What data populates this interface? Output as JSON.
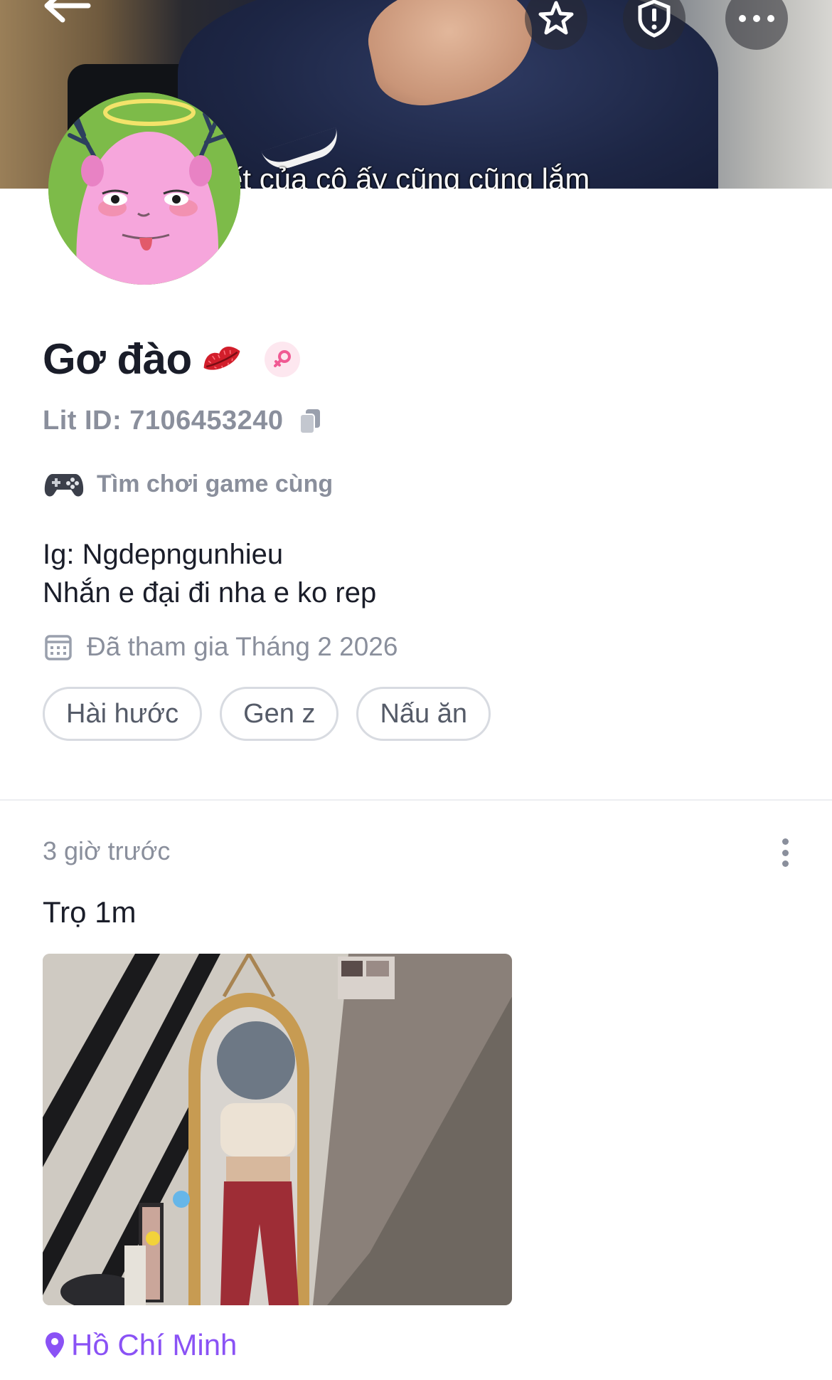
{
  "cover": {
    "subtitle": "ết của cô ấy cũng cũng lắm",
    "icons": [
      "back-arrow-icon",
      "star-icon",
      "report-icon",
      "more-icon"
    ]
  },
  "profile": {
    "name": "Gơ đào",
    "lit_id": "Lit ID: 7106453240",
    "status_label": "Tìm chơi game cùng",
    "bio_lines": [
      "Ig: Ngdepngunhieu",
      "Nhắn e đại đi nha e ko rep"
    ],
    "joined": "Đã tham gia Tháng 2 2026",
    "tags": [
      "Hài hước",
      "Gen z",
      "Nấu ăn"
    ]
  },
  "post": {
    "time": "3 giờ trước",
    "text": "Trọ 1m",
    "location": "Hồ Chí Minh"
  },
  "colors": {
    "accent_purple": "#8a52f5",
    "muted_text": "#8a8f9c",
    "badge_pink": "#f05a93",
    "avatar_bg": "#7dbb49"
  }
}
